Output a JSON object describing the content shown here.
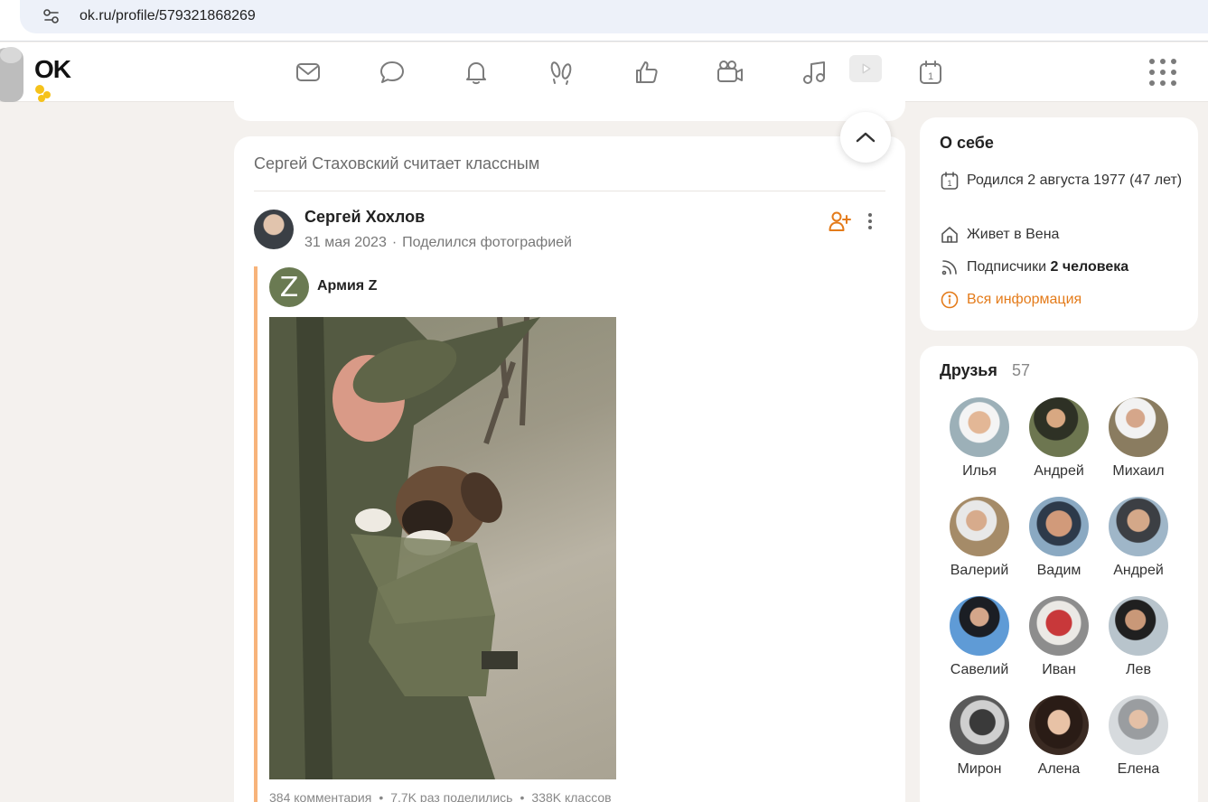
{
  "browser": {
    "url": "ok.ru/profile/579321868269"
  },
  "header": {
    "logo": "OK",
    "nav_icons": [
      "mail-icon",
      "chat-icon",
      "bell-icon",
      "footprints-icon",
      "like-icon",
      "video-camera-icon",
      "music-icon",
      "play-icon",
      "calendar-icon"
    ],
    "calendar_day": "1"
  },
  "post": {
    "header": "Сергей Стаховский считает классным",
    "author": "Сергей Хохлов",
    "date": "31 мая 2023",
    "action": "Поделился фотографией",
    "group_letter": "Z",
    "group_name": "Армия Z",
    "comments": "384 комментария",
    "shares": "7,7K раз поделились",
    "likes": "338K классов"
  },
  "about": {
    "title": "О себе",
    "born": "Родился 2 августа 1977 (47 лет)",
    "lives": "Живет в Вена",
    "subscribers_label": "Подписчики",
    "subscribers_value": "2 человека",
    "all_info": "Вся информация",
    "calendar_day": "1"
  },
  "friends": {
    "title": "Друзья",
    "count": "57",
    "items": [
      {
        "name": "Илья"
      },
      {
        "name": "Андрей"
      },
      {
        "name": "Михаил"
      },
      {
        "name": "Валерий"
      },
      {
        "name": "Вадим"
      },
      {
        "name": "Андрей"
      },
      {
        "name": "Савелий"
      },
      {
        "name": "Иван"
      },
      {
        "name": "Лев"
      },
      {
        "name": "Мирон"
      },
      {
        "name": "Алена"
      },
      {
        "name": "Елена"
      }
    ]
  },
  "colors": {
    "accent": "#e47b1a",
    "repost_bar": "#f7b37a",
    "background": "#f4f1ee"
  }
}
